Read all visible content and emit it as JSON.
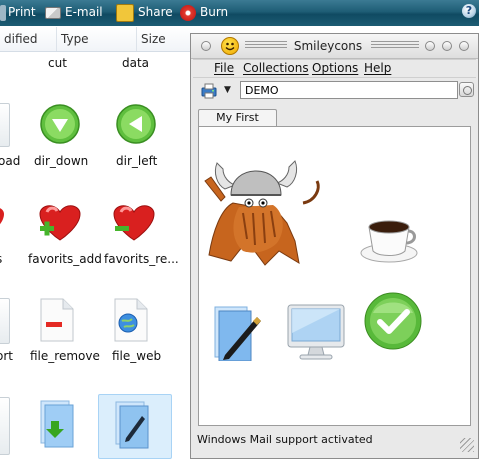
{
  "explorer": {
    "toolbar": {
      "print": "Print",
      "email": "E-mail",
      "share": "Share",
      "burn": "Burn",
      "help": "?"
    },
    "columns": [
      "dified",
      "Type",
      "Size"
    ],
    "top_labels": [
      "cut",
      "data"
    ],
    "rows": [
      {
        "left": "oad",
        "a": "dir_down",
        "b": "dir_left"
      },
      {
        "left": "s",
        "a": "favorits_add",
        "b": "favorits_re..."
      },
      {
        "left": "ort",
        "a": "file_remove",
        "b": "file_web"
      }
    ]
  },
  "window": {
    "title": "Smileycons",
    "menus": [
      "File",
      "Collections",
      "Options",
      "Help"
    ],
    "search_value": "DEMO",
    "tab_label": "My First Group",
    "status": "Windows Mail support activated",
    "emoticons": [
      "viking-icon",
      "coffee-cup-icon",
      "notebook-pen-icon",
      "monitor-icon",
      "green-check-icon"
    ]
  },
  "colors": {
    "toolbar": "#1e5d75",
    "window_bg": "#e9e9e9",
    "selection": "#dbeefc"
  }
}
